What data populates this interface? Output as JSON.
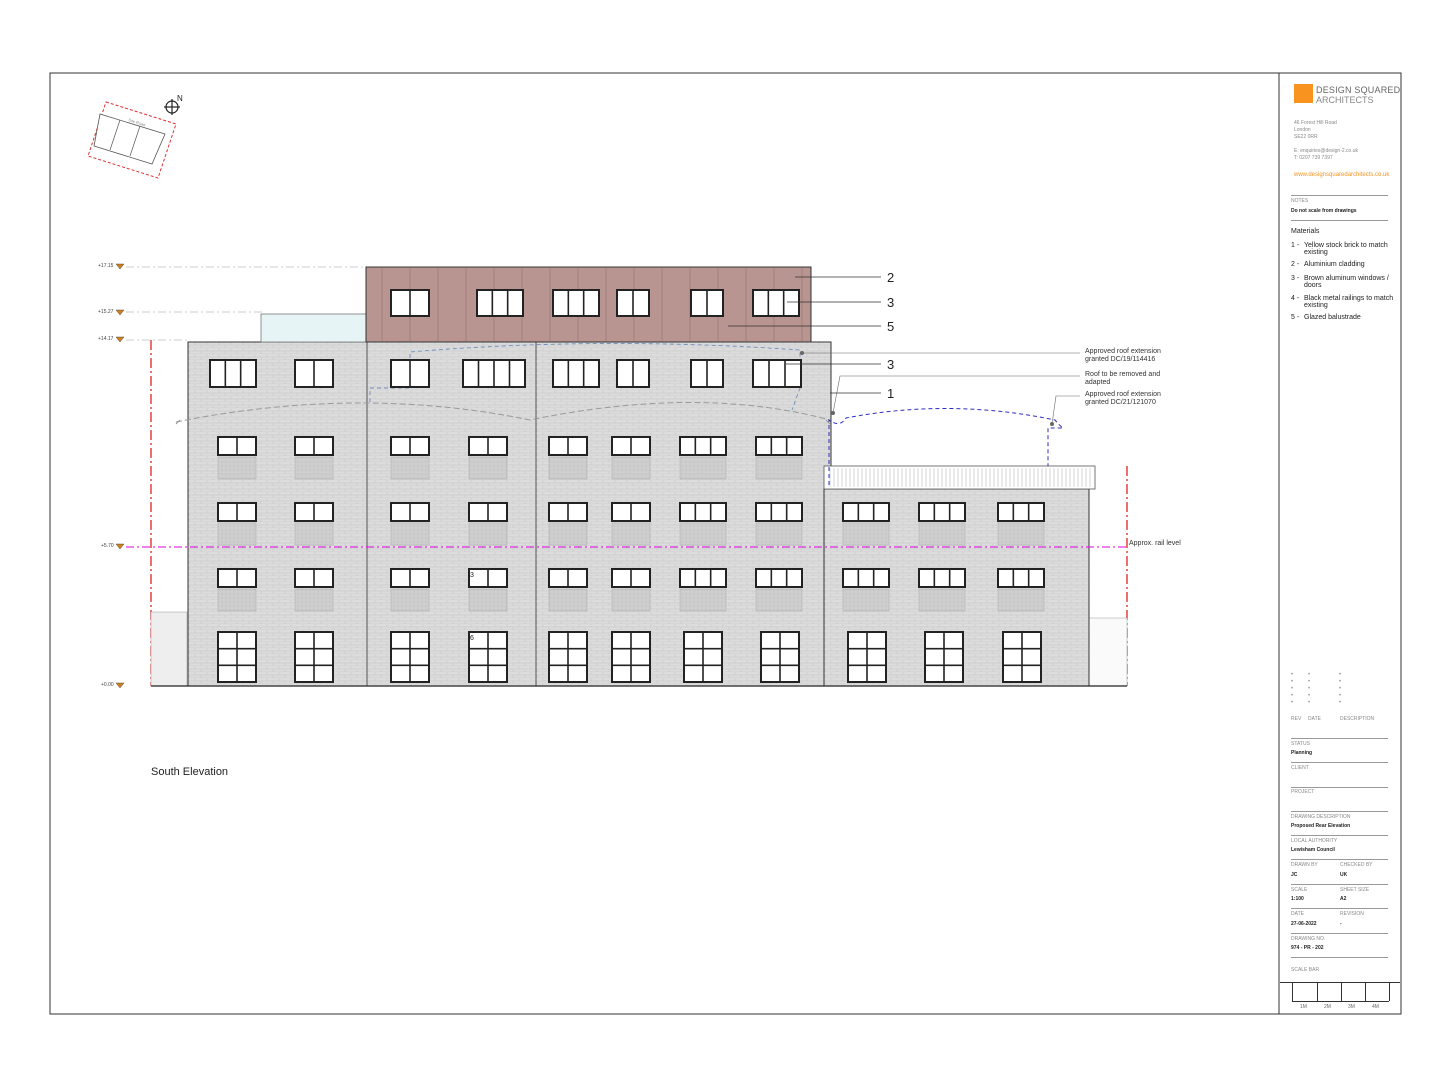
{
  "drawing": {
    "title": "South Elevation",
    "levels": [
      "+17.15",
      "+15.27",
      "+14.17",
      "+5.70",
      "+0.00"
    ],
    "rail_label": "Approx. rail level",
    "callout_numbers": {
      "c2": "2",
      "c3a": "3",
      "c5": "5",
      "c3b": "3",
      "c1": "1",
      "w3": "3",
      "w6": "6"
    },
    "annotations": [
      "Approved roof extension granted DC/19/114416",
      "Roof to be removed and adapted",
      "Approved roof extension granted DC/21/121070"
    ],
    "north_label": "N",
    "site_plan_label": "Site Road",
    "colors": {
      "cladding": "#b89590",
      "brick": "#dcdcdc",
      "rail_line": "#e000e0",
      "boundary": "#e01010",
      "extension_outline": "#3030c0",
      "brand": "#f7931e"
    }
  },
  "titleblock": {
    "company_line1": "DESIGN SQUARED",
    "company_line2": "ARCHITECTS",
    "address": [
      "46 Forest Hill Road",
      "London",
      "SE22 0RR"
    ],
    "email": "E: enquiries@design-2.co.uk",
    "phone": "T: 0207 739 7397",
    "website": "www.designsquaredarchitects.co.uk",
    "notes_label": "NOTES",
    "notes_value": "Do not scale from drawings",
    "materials_heading": "Materials",
    "materials": [
      {
        "num": "1 -",
        "text": "Yellow stock brick to match existing"
      },
      {
        "num": "2 -",
        "text": "Aluminium cladding"
      },
      {
        "num": "3 -",
        "text": "Brown aluminum windows / doors"
      },
      {
        "num": "4 -",
        "text": "Black metal railings to match existing"
      },
      {
        "num": "5 -",
        "text": "Glazed balustrade"
      }
    ],
    "rev_headers": {
      "rev": "REV",
      "date": "DATE",
      "desc": "DESCRIPTION"
    },
    "status_label": "STATUS",
    "status_value": "Planning",
    "client_label": "CLIENT",
    "project_label": "PROJECT",
    "drawing_desc_label": "DRAWING DESCRIPTION",
    "drawing_desc_value": "Proposed Rear Elevation",
    "authority_label": "LOCAL AUTHORITY",
    "authority_value": "Lewisham Council",
    "drawn_by_label": "DRAWN BY",
    "drawn_by_value": "JC",
    "checked_by_label": "CHECKED BY",
    "checked_by_value": "UK",
    "scale_label": "SCALE",
    "scale_value": "1:100",
    "sheet_size_label": "SHEET SIZE",
    "sheet_size_value": "A2",
    "date_label": "DATE",
    "date_value": "27-06-2022",
    "revision_label": "REVISION",
    "revision_value": "-",
    "drawing_no_label": "DRAWING NO.",
    "drawing_no_value": "974 - PR - 202",
    "scale_bar_label": "SCALE BAR",
    "scale_bar_ticks": [
      "1M",
      "2M",
      "3M",
      "4M"
    ]
  }
}
